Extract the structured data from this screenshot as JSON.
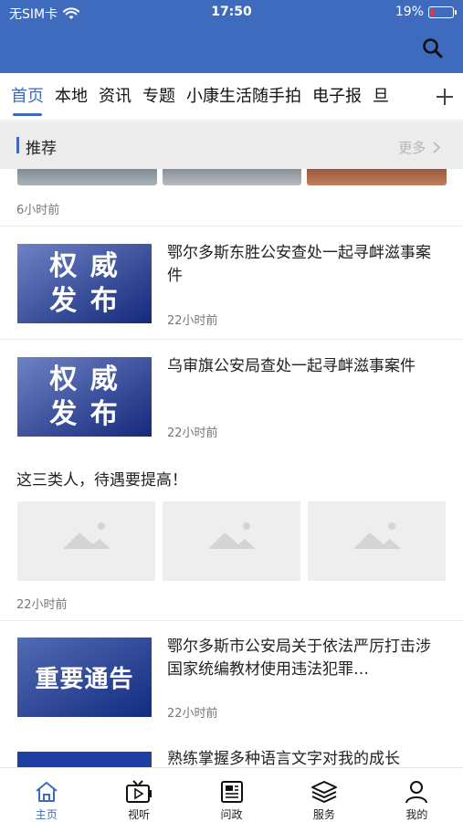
{
  "status_bar": {
    "carrier": "无SIM卡",
    "time": "17:50",
    "battery": "19%",
    "battery_level": 0.19,
    "battery_color": "#e53935"
  },
  "header": {
    "bg_color": "#3f6bbf",
    "search_icon": "search-icon"
  },
  "tabs": {
    "items": [
      {
        "label": "首页",
        "active": true
      },
      {
        "label": "本地"
      },
      {
        "label": "资讯"
      },
      {
        "label": "专题"
      },
      {
        "label": "小康生活随手拍"
      },
      {
        "label": "电子报"
      },
      {
        "label": "旦"
      }
    ],
    "add_icon": "plus-icon"
  },
  "recommend": {
    "title": "推荐",
    "more": "更多"
  },
  "feed": {
    "top_item_time": "6小时前",
    "items": [
      {
        "title": "鄂尔多斯东胜公安查处一起寻衅滋事案件",
        "time": "22小时前",
        "thumb_text": [
          "权 威",
          "发 布"
        ]
      },
      {
        "title": "乌审旗公安局查处一起寻衅滋事案件",
        "time": "22小时前",
        "thumb_text": [
          "权 威",
          "发 布"
        ]
      },
      {
        "title": "这三类人，待遇要提高！",
        "time": "22小时前"
      },
      {
        "title": "鄂尔多斯市公安局关于依法严厉打击涉国家统编教材使用违法犯罪…",
        "time": "22小时前",
        "thumb_text": [
          "重要通告"
        ]
      },
      {
        "title": "熟练掌握多种语言文字对我的成长"
      }
    ]
  },
  "bottom_nav": [
    {
      "label": "主页",
      "icon": "home-icon",
      "active": true
    },
    {
      "label": "视听",
      "icon": "tv-icon"
    },
    {
      "label": "问政",
      "icon": "document-icon"
    },
    {
      "label": "服务",
      "icon": "layers-icon"
    },
    {
      "label": "我的",
      "icon": "user-icon"
    }
  ],
  "colors": {
    "accent": "#3f6bbf",
    "thumb_blue": "#1f3fa3"
  }
}
